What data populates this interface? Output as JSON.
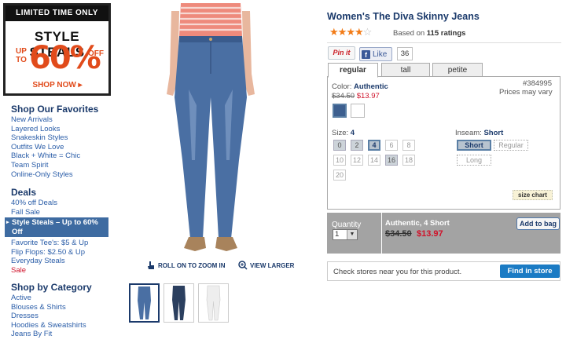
{
  "promo": {
    "top_bar": "LIMITED TIME ONLY",
    "headline": "STYLE STEALS",
    "up_to": "UP TO",
    "percent": "60%",
    "off": "OFF",
    "cta": "SHOP NOW ▸"
  },
  "sidebar": {
    "favorites_title": "Shop Our Favorites",
    "favorites": [
      "New Arrivals",
      "Layered Looks",
      "Snakeskin Styles",
      "Outfits We Love",
      "Black + White = Chic",
      "Team Spirit",
      "Online-Only Styles"
    ],
    "deals_title": "Deals",
    "deals_before": [
      "40% off Deals",
      "Fall Sale"
    ],
    "deals_highlight": "Style Steals – Up to 60% Off",
    "deals_after": [
      "Favorite Tee's: $5 & Up",
      "Flip Flops: $2.50 & Up",
      "Everyday Steals"
    ],
    "deals_sale": "Sale",
    "category_title": "Shop by Category",
    "categories": [
      "Active",
      "Blouses & Shirts",
      "Dresses",
      "Hoodies & Sweatshirts",
      "Jeans By Fit"
    ]
  },
  "image": {
    "roll_zoom": "ROLL ON TO ZOOM IN",
    "view_larger": "VIEW LARGER"
  },
  "product": {
    "title": "Women's The Diva Skinny Jeans",
    "rating": 4,
    "rating_max": 5,
    "rating_prefix": "Based on ",
    "rating_count": "115 ratings",
    "pinit": "Pin it",
    "fb_like": "Like",
    "fb_count": "36",
    "tabs": [
      "regular",
      "tall",
      "petite"
    ],
    "color_label": "Color: ",
    "color_value": "Authentic",
    "item_number": "#384995",
    "price_note": "Prices may vary",
    "old_price": "$34.50",
    "new_price": "$13.97",
    "swatch_colors": [
      "#3d5f8f",
      "#ffffff"
    ],
    "size_label": "Size: ",
    "size_value": "4",
    "sizes_row1": [
      "0",
      "2",
      "4",
      "6",
      "8"
    ],
    "sizes_row2": [
      "10",
      "12",
      "14",
      "16",
      "18"
    ],
    "sizes_row3": [
      "20"
    ],
    "inseam_label": "Inseam: ",
    "inseam_value": "Short",
    "inseam_options": [
      "Short",
      "Regular",
      "Long"
    ],
    "size_chart": "size chart",
    "quantity_label": "Quantity",
    "quantity_value": "1",
    "selection": "Authentic, 4 Short",
    "add_to_bag": "Add to bag",
    "stores_text": "Check stores near you for this product.",
    "find_in_store": "Find in store"
  }
}
